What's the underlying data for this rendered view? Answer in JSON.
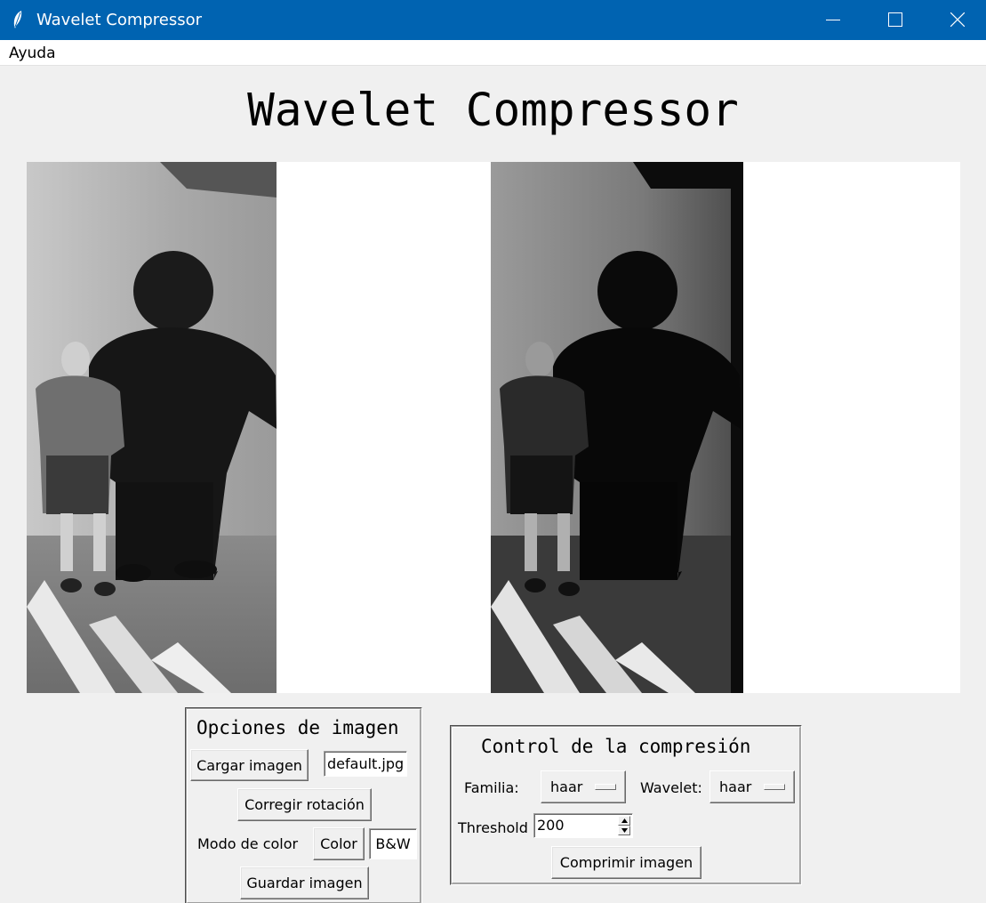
{
  "window": {
    "title": "Wavelet Compressor",
    "icon": "feather-icon",
    "controls": [
      "minimize-icon",
      "maximize-icon",
      "close-icon"
    ],
    "titlebar_color": "#0063b1"
  },
  "menubar": {
    "items": [
      {
        "label": "Ayuda"
      }
    ]
  },
  "heading": "Wavelet Compressor",
  "images": {
    "original": {
      "description_icon": "photo-grayscale"
    },
    "compressed": {
      "description_icon": "photo-grayscale-dark"
    }
  },
  "image_options": {
    "title": "Opciones de imagen",
    "load_button": "Cargar imagen",
    "filename_value": "default.jpg",
    "rotate_button": "Corregir rotación",
    "color_mode_label": "Modo de color",
    "color_button": "Color",
    "bw_button": "B&W",
    "save_button": "Guardar imagen"
  },
  "compression": {
    "title": "Control de la compresión",
    "family_label": "Familia:",
    "family_value": "haar",
    "wavelet_label": "Wavelet:",
    "wavelet_value": "haar",
    "threshold_label": "Threshold",
    "threshold_value": "200",
    "compress_button": "Comprimir imagen"
  }
}
